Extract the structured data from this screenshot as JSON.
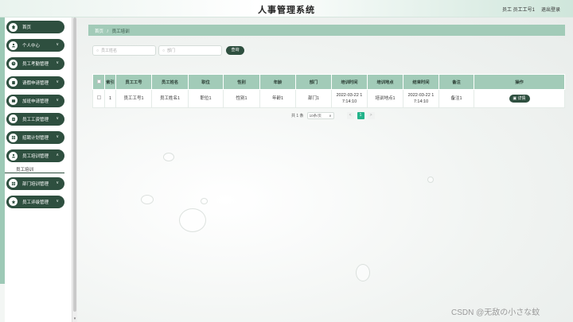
{
  "app": {
    "title": "人事管理系统"
  },
  "header": {
    "user": "员工 员工工号1",
    "logout": "退出登录"
  },
  "sidebar": {
    "items": [
      {
        "label": "首页",
        "icon": "home-icon",
        "chevron": false
      },
      {
        "label": "个人中心",
        "icon": "user-icon",
        "chevron": true
      },
      {
        "label": "员工考勤管理",
        "icon": "clock-icon",
        "chevron": true
      },
      {
        "label": "请假申请管理",
        "icon": "leave-icon",
        "chevron": true
      },
      {
        "label": "加班申请管理",
        "icon": "overtime-icon",
        "chevron": true
      },
      {
        "label": "员工工资管理",
        "icon": "salary-icon",
        "chevron": true
      },
      {
        "label": "招聘计划管理",
        "icon": "plan-icon",
        "chevron": true
      },
      {
        "label": "员工培训管理",
        "icon": "training-icon",
        "chevron": true,
        "expanded": true,
        "sub": "员工培训"
      },
      {
        "label": "部门培训管理",
        "icon": "dept-icon",
        "chevron": true
      },
      {
        "label": "员工评级管理",
        "icon": "rating-icon",
        "chevron": true
      }
    ]
  },
  "breadcrumb": {
    "home": "首页",
    "sep": "/",
    "current": "员工培训"
  },
  "search": {
    "name_placeholder": "员工姓名",
    "dept_placeholder": "部门",
    "button": "查询"
  },
  "table": {
    "headers": [
      "索引",
      "员工工号",
      "员工姓名",
      "职位",
      "性别",
      "年龄",
      "部门",
      "培训时间",
      "培训地点",
      "结束时间",
      "备注",
      "操作"
    ],
    "rows": [
      {
        "index": "1",
        "emp_no": "员工工号1",
        "emp_name": "员工姓名1",
        "position": "职位1",
        "gender": "性别1",
        "age": "年龄1",
        "dept": "部门1",
        "train_time": "2022-03-22 1 7:14:10",
        "train_place": "培训地点1",
        "end_time": "2022-03-22 1 7:14:10",
        "remark": "备注1",
        "action": "详情"
      }
    ]
  },
  "pager": {
    "total": "共 1 条",
    "page_size": "10条/页",
    "prev": "<",
    "current_page": "1",
    "next": ">"
  },
  "watermark": "CSDN @无敌の小さな蚊",
  "colors": {
    "accent": "#2e4f3f",
    "header_bg": "#a2cbb8",
    "page_active": "#23b38a"
  }
}
